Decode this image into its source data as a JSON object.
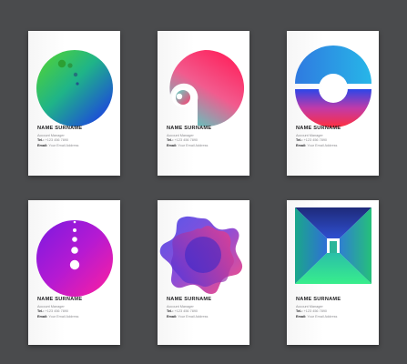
{
  "cards": [
    {
      "name": "NAME SURNAME",
      "role": "Account Manager",
      "tel_label": "Tel.:",
      "tel": "+123 456 7890",
      "email_label": "Email:",
      "email": "Your Email Address",
      "graphic": "planet-dots-circle"
    },
    {
      "name": "NAME SURNAME",
      "role": "Account Manager",
      "tel_label": "Tel.:",
      "tel": "+123 456 7890",
      "email_label": "Email:",
      "email": "Your Email Address",
      "graphic": "cutout-circle"
    },
    {
      "name": "NAME SURNAME",
      "role": "Account Manager",
      "tel_label": "Tel.:",
      "tel": "+123 456 7890",
      "email_label": "Email:",
      "email": "Your Email Address",
      "graphic": "split-ring"
    },
    {
      "name": "NAME SURNAME",
      "role": "Account Manager",
      "tel_label": "Tel.:",
      "tel": "+123 456 7890",
      "email_label": "Email:",
      "email": "Your Email Address",
      "graphic": "dots-column-circle"
    },
    {
      "name": "NAME SURNAME",
      "role": "Account Manager",
      "tel_label": "Tel.:",
      "tel": "+123 456 7890",
      "email_label": "Email:",
      "email": "Your Email Address",
      "graphic": "wavy-flower"
    },
    {
      "name": "NAME SURNAME",
      "role": "Account Manager",
      "tel_label": "Tel.:",
      "tel": "+123 456 7890",
      "email_label": "Email:",
      "email": "Your Email Address",
      "graphic": "tunnel-square"
    }
  ],
  "colors": {
    "background": "#4a4b4d",
    "card": "#ffffff",
    "green": "#3ad36a",
    "blue": "#1f4fe0",
    "pink": "#ff2f6a",
    "purple": "#8a1dd6",
    "magenta": "#e81ca8",
    "teal": "#25d3b0"
  }
}
